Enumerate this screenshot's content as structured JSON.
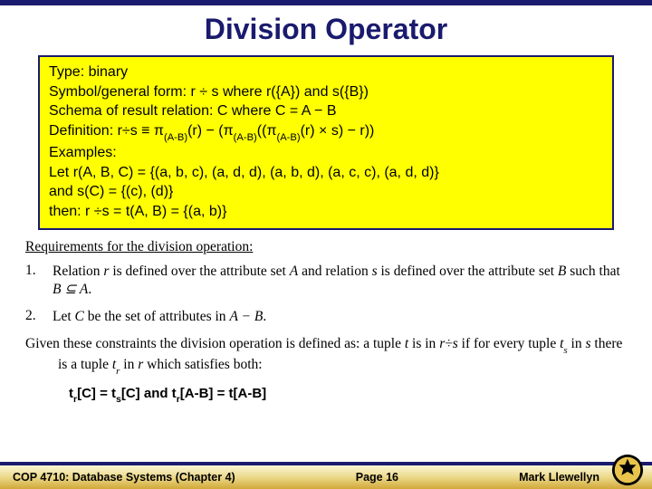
{
  "title": "Division Operator",
  "box": {
    "l1": "Type: binary",
    "l2": "Symbol/general form:  r ÷ s where r({A}) and s({B})",
    "l3": "Schema of result relation: C where C = A − B",
    "l4_pre": "Definition: r÷s ≡ π",
    "l4_s1": "(A-B)",
    "l4_mid1": "(r) − (π",
    "l4_s2": "(A-B)",
    "l4_mid2": "((π",
    "l4_s3": "(A-B)",
    "l4_post": "(r) × s) − r))",
    "l5": " Examples:",
    "l6": "Let r(A, B, C) = {(a, b, c), (a, d, d), (a, b, d), (a, c, c), (a, d, d)}",
    "l7": "and s(C) = {(c), (d)}",
    "l8": "then: r ÷s = t(A, B) = {(a, b)}"
  },
  "req_heading": "Requirements for the division operation:",
  "item1": {
    "num": "1.",
    "a": "Relation ",
    "b": "r",
    "c": " is defined over the attribute set ",
    "d": "A",
    "e": " and relation ",
    "f": "s",
    "g": " is defined over the attribute set ",
    "h": "B",
    "i": " such that ",
    "j": "B ⊆ A",
    "k": "."
  },
  "item2": {
    "num": "2.",
    "a": "Let ",
    "b": "C",
    "c": " be the set of attributes in ",
    "d": "A − B",
    "e": "."
  },
  "given": {
    "a": "Given these constraints the division operation is defined as: a tuple ",
    "b": "t",
    "c": " is in ",
    "d": "r÷s",
    "e": " if for every tuple ",
    "f": "t",
    "fs": "s",
    "g": " in ",
    "h": "s",
    "i": " there is a tuple ",
    "j": "t",
    "js": "r",
    "k": " in ",
    "l": "r",
    "m": " which satisfies both:"
  },
  "formula": {
    "a": "t",
    "as": "r",
    "b": "[C] = t",
    "bs": "s",
    "c": "[C]  and  t",
    "cs": "r",
    "d": "[A-B] = t[A-B]"
  },
  "footer": {
    "course": "COP 4710: Database Systems  (Chapter 4)",
    "page": "Page 16",
    "author": "Mark Llewellyn"
  }
}
